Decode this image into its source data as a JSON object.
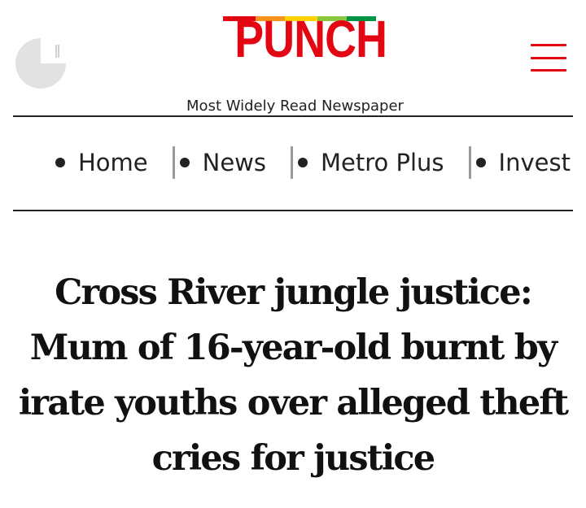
{
  "header": {
    "logo_text": "PUNCH",
    "logo_colors": [
      "#e30613",
      "#f7931e",
      "#ffd200",
      "#8cc63f",
      "#009245"
    ],
    "tagline": "Most Widely Read Newspaper",
    "clock_icon": "clock-icon",
    "menu_icon": "hamburger-menu-icon",
    "accent_color": "#e30613"
  },
  "nav": {
    "items": [
      {
        "label": "Home"
      },
      {
        "label": "News"
      },
      {
        "label": "Metro Plus"
      },
      {
        "label": "Invest"
      }
    ]
  },
  "article": {
    "headline": "Cross River jungle justice: Mum of 16-year-old burnt by irate youths over alleged theft cries for justice"
  }
}
